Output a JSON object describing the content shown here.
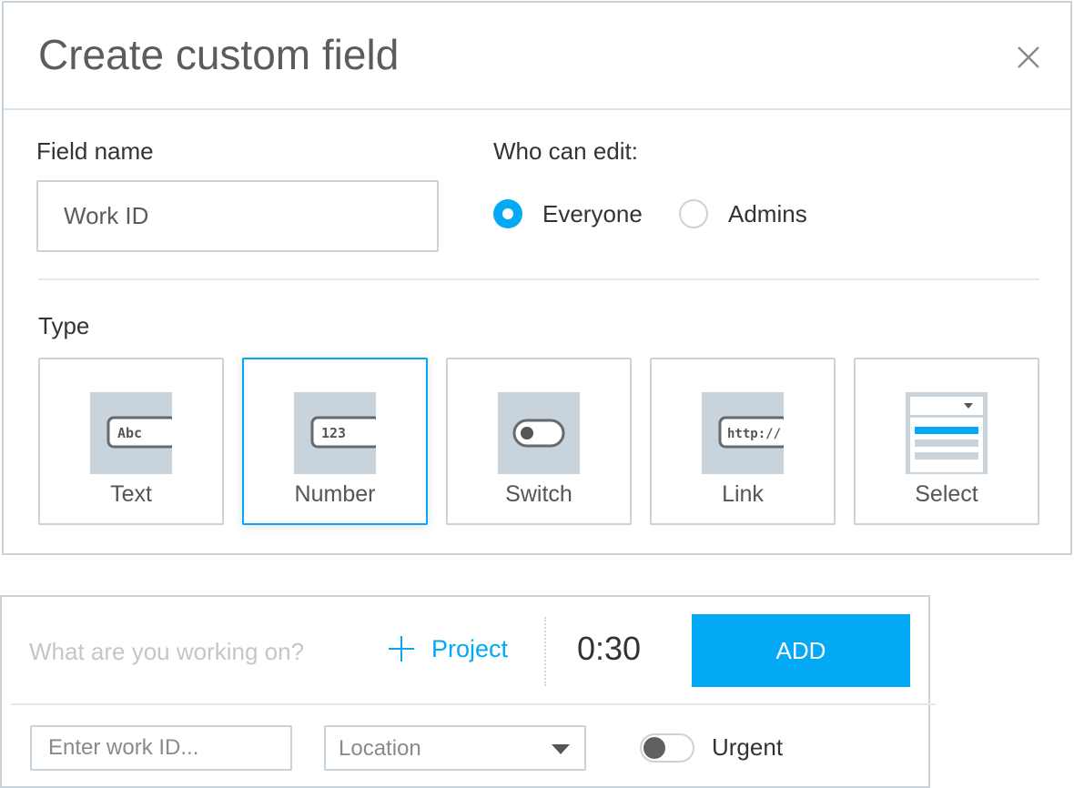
{
  "modal": {
    "title": "Create custom field",
    "close_icon": "close-icon",
    "field_name_label": "Field name",
    "field_name_value": "Work ID",
    "who_can_edit_label": "Who can edit:",
    "edit_options": [
      {
        "label": "Everyone",
        "selected": true
      },
      {
        "label": "Admins",
        "selected": false
      }
    ],
    "type_label": "Type",
    "types": [
      {
        "label": "Text",
        "icon": "text-field-icon",
        "icon_text": "Abc",
        "selected": false
      },
      {
        "label": "Number",
        "icon": "number-field-icon",
        "icon_text": "123",
        "selected": true
      },
      {
        "label": "Switch",
        "icon": "switch-field-icon",
        "selected": false
      },
      {
        "label": "Link",
        "icon": "link-field-icon",
        "icon_text": "http://",
        "selected": false
      },
      {
        "label": "Select",
        "icon": "select-field-icon",
        "selected": false
      }
    ]
  },
  "tracker": {
    "description_placeholder": "What are you working on?",
    "project_label": "Project",
    "timer": "0:30",
    "add_label": "ADD",
    "work_id_placeholder": "Enter work ID...",
    "location_value": "Location",
    "urgent_label": "Urgent",
    "urgent_on": false
  },
  "colors": {
    "accent": "#03a9f4",
    "border": "#c8d3db",
    "icon_bg": "#c8d3db"
  }
}
